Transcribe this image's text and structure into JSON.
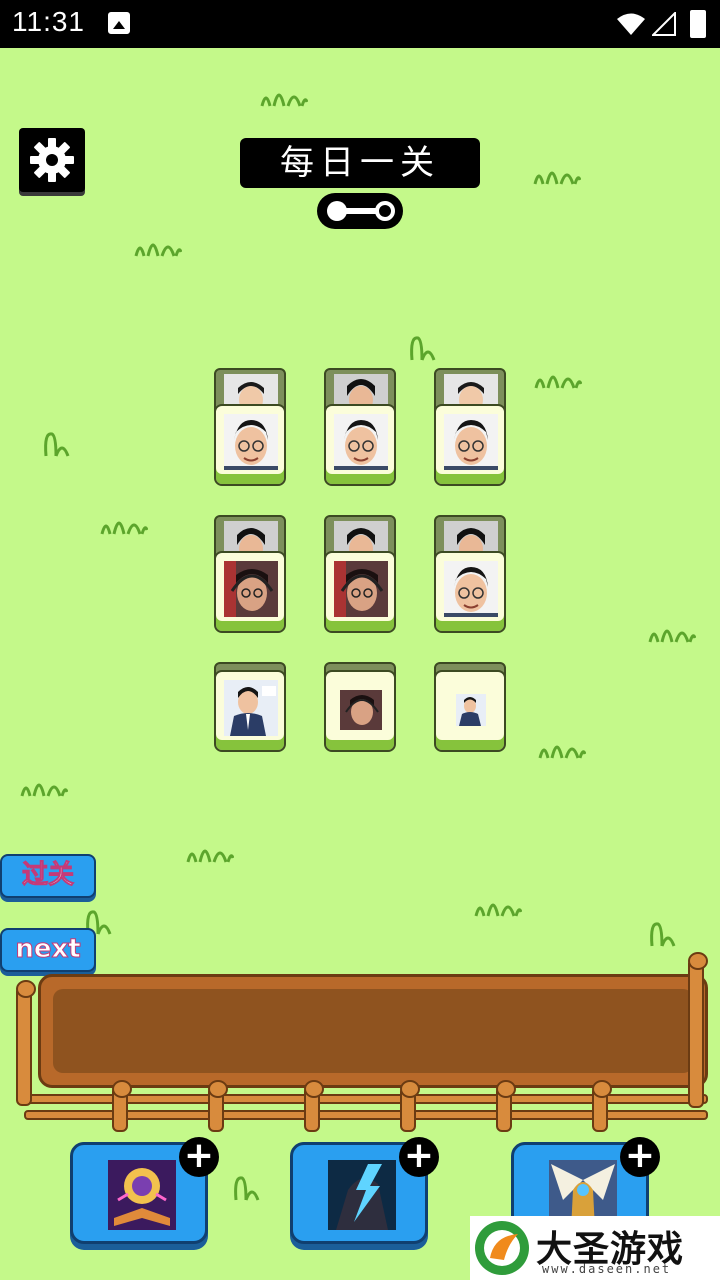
{
  "status_bar": {
    "time": "11:31",
    "icons": [
      "gallery-icon",
      "wifi-icon",
      "signal-icon",
      "battery-icon"
    ]
  },
  "header": {
    "title": "每日一关",
    "settings_icon": "gear-icon",
    "key_icon": "key-icon"
  },
  "board": {
    "rows": [
      {
        "tiles": [
          {
            "face": "man-glasses-smiling"
          },
          {
            "face": "man-glasses-smiling"
          },
          {
            "face": "man-glasses-smiling"
          }
        ],
        "under": [
          "man-suit",
          "man-dark-hair",
          "man-suit"
        ]
      },
      {
        "tiles": [
          {
            "face": "man-headset-streamer"
          },
          {
            "face": "man-headset-streamer"
          },
          {
            "face": "man-glasses-smiling"
          }
        ],
        "under": [
          "man-dark-hair",
          "man-dark-hair",
          "man-dark-hair"
        ]
      },
      {
        "tiles": [
          {
            "face": "man-suit-poster"
          },
          {
            "face": "man-headset-small"
          },
          {
            "face": "man-suit-small"
          }
        ],
        "under": []
      }
    ]
  },
  "side_buttons": {
    "pass_label": "过关",
    "next_label": "next"
  },
  "powerups": [
    {
      "icon": "magic-book-icon",
      "plus": "+"
    },
    {
      "icon": "lightning-warrior-icon",
      "plus": "+"
    },
    {
      "icon": "winged-knight-icon",
      "plus": "+"
    }
  ],
  "watermark": {
    "title": "大圣游戏网",
    "url": "www.daseen.net"
  },
  "colors": {
    "background": "#c4f98a",
    "button_blue": "#2a9ff0",
    "tray_wood": "#b8692a",
    "tile_face": "#fbfdda",
    "tile_base": "#86c33c"
  }
}
